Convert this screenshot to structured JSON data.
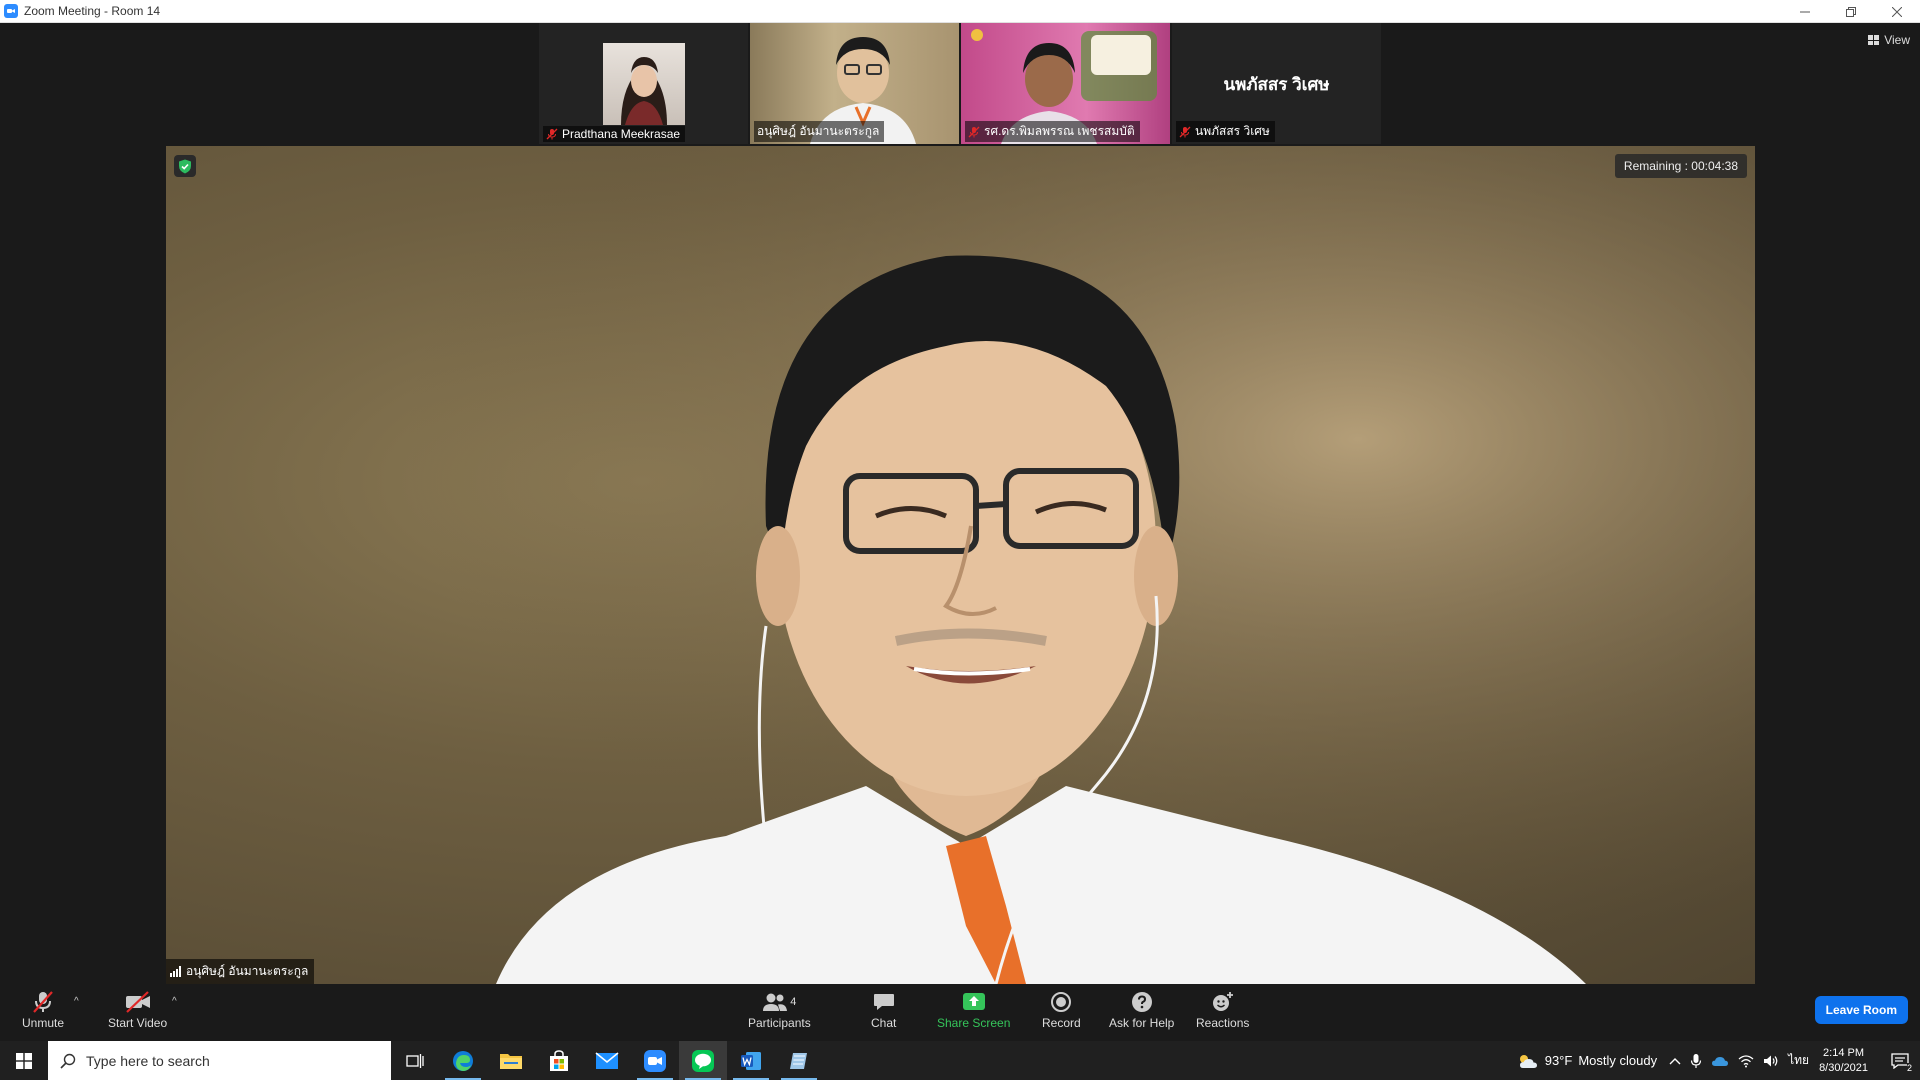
{
  "window": {
    "title": "Zoom Meeting - Room 14"
  },
  "view_button": {
    "label": "View"
  },
  "participants_strip": [
    {
      "name": "Pradthana Meekrasae",
      "muted": true,
      "has_video": true
    },
    {
      "name": "อนุศิษฎ์ อันมานะตระกูล",
      "muted": false,
      "has_video": true,
      "active": true
    },
    {
      "name": "รศ.ดร.พิมลพรรณ เพชรสมบัติ",
      "muted": true,
      "has_video": true
    },
    {
      "name": "นพภัสสร วิเศษ",
      "muted": true,
      "has_video": false,
      "display_text": "นพภัสสร วิเศษ"
    }
  ],
  "main_video": {
    "speaker_name": "อนุศิษฎ์ อันมานะตระกูล",
    "remaining": "Remaining : 00:04:38"
  },
  "toolbar": {
    "unmute": "Unmute",
    "start_video": "Start Video",
    "participants": "Participants",
    "participants_count": "4",
    "chat": "Chat",
    "share_screen": "Share Screen",
    "record": "Record",
    "ask_for_help": "Ask for Help",
    "reactions": "Reactions",
    "leave_room": "Leave Room"
  },
  "taskbar": {
    "search_placeholder": "Type here to search",
    "weather_temp": "93°F",
    "weather_desc": "Mostly cloudy",
    "language": "ไทย",
    "time": "2:14 PM",
    "date": "8/30/2021",
    "notification_count": "2"
  },
  "colors": {
    "share_green": "#35c45a",
    "leave_blue": "#0e72ed",
    "active_border": "#a4d65e",
    "muted_red": "#e02828"
  }
}
